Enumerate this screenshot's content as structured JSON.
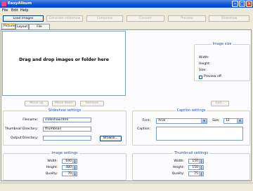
{
  "window": {
    "title": "EasyAlbum",
    "min": "–",
    "max": "□",
    "close": "×"
  },
  "menu": [
    "File",
    "Edit",
    "Help"
  ],
  "toolbar": {
    "load_images": "Load Images",
    "generate": "Generate slideshow",
    "compress": "Compress",
    "convert": "Convert",
    "preview": "Preview",
    "slideshow": "Slideshow"
  },
  "tabs": [
    "Pictures",
    "Layout",
    "File manager"
  ],
  "drop_area": {
    "text": "Drag and drop images or folder here"
  },
  "image_size": {
    "title": "Image size",
    "width_label": "Width:",
    "height_label": "Height:",
    "size_label": "Size:",
    "preview_off": "Preview off"
  },
  "list_buttons": {
    "move_up": "Move up",
    "move_down": "Move down",
    "remove": "Remove",
    "exif": "Exif..."
  },
  "slideshow": {
    "title": "Slideshow settings",
    "filename_label": "Filename:",
    "filename": "slideshow.html",
    "thumb_dir_label": "Thumbnail Directory:",
    "thumb_dir": "thumbnail",
    "output_dir_label": "Output Directory:",
    "output_dir": "",
    "browse": "Browse..."
  },
  "caption": {
    "title": "Caption settings",
    "font_label": "Font:",
    "font": "Arial",
    "size_label": "Size:",
    "size": "12",
    "caption_label": "Caption:"
  },
  "image_settings": {
    "title": "Image settings",
    "width_label": "Width:",
    "width": "640",
    "height_label": "Height:",
    "height": "480",
    "quality_label": "Quality:",
    "quality": "70"
  },
  "thumb_settings": {
    "title": "Thumbnail settings",
    "width_label": "Width:",
    "width": "150",
    "height_label": "Height:",
    "height": "150",
    "quality_label": "Quality:",
    "quality": "75"
  },
  "colors": {
    "titlebar": "#0a53d8",
    "group_title": "#1f4ea8",
    "window_bg": "#ece9d8"
  }
}
